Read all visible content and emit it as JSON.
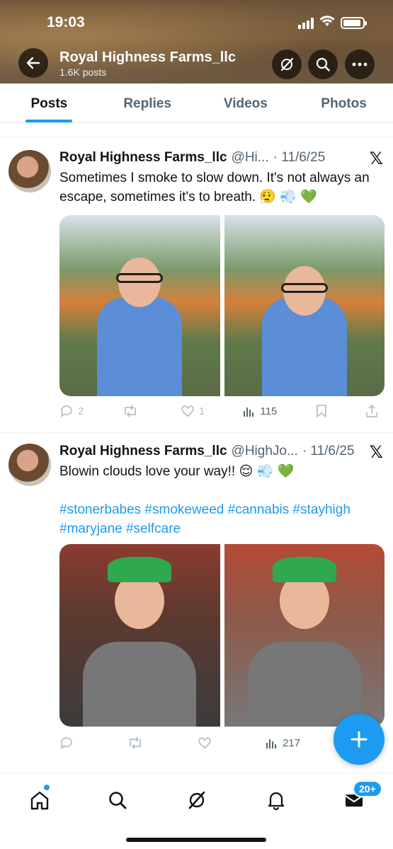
{
  "status_bar": {
    "time": "19:03"
  },
  "header": {
    "title": "Royal Highness Farms_llc",
    "subtitle": "1.6K posts"
  },
  "tabs": [
    {
      "label": "Posts",
      "active": true
    },
    {
      "label": "Replies",
      "active": false
    },
    {
      "label": "Videos",
      "active": false
    },
    {
      "label": "Photos",
      "active": false
    }
  ],
  "posts": [
    {
      "name": "Royal Highness Farms_llc",
      "handle": "@Hi...",
      "date": "· 11/6/25",
      "text": "Sometimes I smoke to slow down. It's not always an escape, sometimes it's to breath. 😮‍💨 💨 💚",
      "hashtags": "",
      "actions": {
        "replies": "2",
        "reposts": "",
        "likes": "1",
        "views": "115"
      }
    },
    {
      "name": "Royal Highness Farms_llc",
      "handle": "@HighJo...",
      "date": "· 11/6/25",
      "text": "Blowin clouds love your way!! 😌 💨 💚",
      "hashtags": "#stonerbabes #smokeweed #cannabis #stayhigh #maryjane #selfcare",
      "actions": {
        "replies": "",
        "reposts": "",
        "likes": "",
        "views": "217"
      }
    }
  ],
  "bottom_nav": {
    "items": [
      "home-icon",
      "search-icon",
      "grok-icon",
      "bell-icon",
      "mail-icon"
    ],
    "mail_badge": "20+"
  },
  "colors": {
    "accent": "#1d9bf0",
    "text": "#0f1419",
    "muted": "#536471"
  }
}
